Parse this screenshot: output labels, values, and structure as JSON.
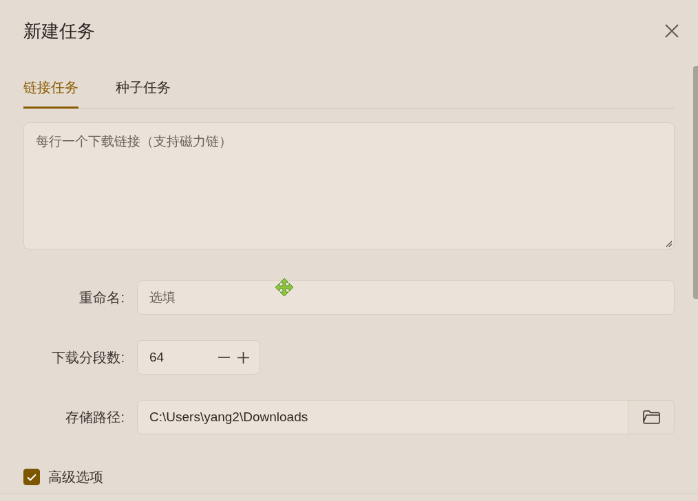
{
  "dialog": {
    "title": "新建任务"
  },
  "tabs": [
    {
      "label": "链接任务",
      "selected": true
    },
    {
      "label": "种子任务",
      "selected": false
    }
  ],
  "links_field": {
    "placeholder": "每行一个下载链接（支持磁力链）"
  },
  "form": [
    {
      "kind": "text",
      "label": "重命名:",
      "placeholder": "选填"
    },
    {
      "kind": "stepper",
      "label": "下载分段数:",
      "value": "64"
    },
    {
      "kind": "path",
      "label": "存储路径:",
      "value": "C:\\Users\\yang2\\Downloads"
    }
  ],
  "advanced_options": {
    "label": "高级选项",
    "checked": true
  }
}
